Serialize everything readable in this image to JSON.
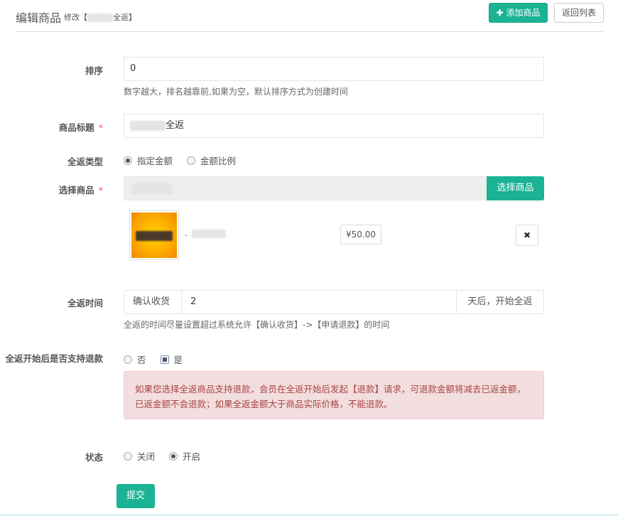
{
  "header": {
    "title": "编辑商品",
    "subtitle_prefix": "修改【",
    "subtitle_suffix": "全返】",
    "add_button": "添加商品",
    "back_button": "返回列表"
  },
  "form": {
    "sort": {
      "label": "排序",
      "value": "0",
      "help": "数字越大，排名越靠前,如果为空，默认排序方式为创建时间"
    },
    "title": {
      "label": "商品标题",
      "required_mark": "*",
      "value_suffix": "全返"
    },
    "return_type": {
      "label": "全返类型",
      "options": [
        "指定金额",
        "金额比例"
      ],
      "selected": "指定金额"
    },
    "goods": {
      "label": "选择商品",
      "required_mark": "*",
      "choose_button": "选择商品",
      "item_name_prefix": ".",
      "item_price": "¥50.00",
      "delete_icon": "close-icon"
    },
    "return_time": {
      "label": "全返时间",
      "prefix": "确认收货",
      "value": "2",
      "suffix": "天后，开始全返",
      "help": "全返的时间尽量设置超过系统允许【确认收货】->【申请退款】的时间"
    },
    "refund": {
      "label": "全返开始后是否支持退款",
      "options": [
        "否",
        "是"
      ],
      "selected": "是",
      "alert": "如果您选择全返商品支持退款，会员在全返开始后发起【退款】请求，可退款金额将减去已返金额，已返金额不会退款；如果全返金额大于商品实际价格，不能退款。"
    },
    "status": {
      "label": "状态",
      "options": [
        "关闭",
        "开启"
      ],
      "selected": "开启"
    },
    "submit": "提交"
  },
  "colors": {
    "primary": "#1ab394",
    "alert_bg": "#f2dede",
    "alert_text": "#a94442",
    "required": "#ed5565"
  }
}
